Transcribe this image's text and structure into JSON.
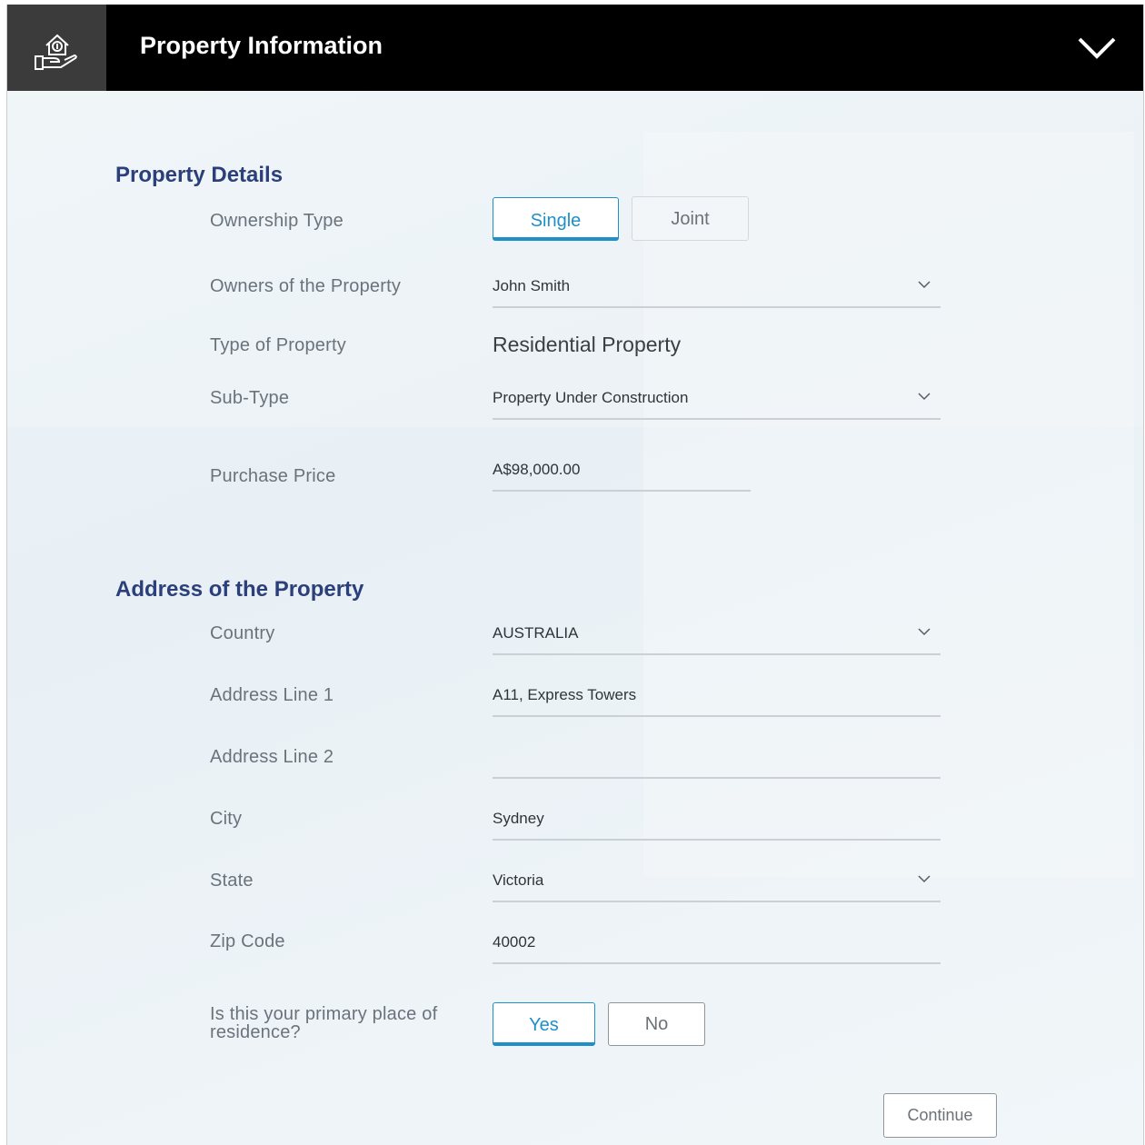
{
  "header": {
    "title": "Property Information",
    "icon": "home-loan-icon",
    "toggle_icon": "chevron-down-icon"
  },
  "property_details": {
    "section_title": "Property Details",
    "ownership_type": {
      "label": "Ownership Type",
      "options": [
        "Single",
        "Joint"
      ],
      "selected": "Single"
    },
    "owners": {
      "label": "Owners of the Property",
      "value": "John Smith"
    },
    "type_of_property": {
      "label": "Type of Property",
      "value": "Residential Property"
    },
    "sub_type": {
      "label": "Sub-Type",
      "value": "Property Under Construction"
    },
    "purchase_price": {
      "label": "Purchase Price",
      "value": "A$98,000.00"
    }
  },
  "address": {
    "section_title": "Address of the Property",
    "country": {
      "label": "Country",
      "value": "AUSTRALIA"
    },
    "address_line_1": {
      "label": "Address Line 1",
      "value": "A11, Express Towers"
    },
    "address_line_2": {
      "label": "Address Line 2",
      "value": ""
    },
    "city": {
      "label": "City",
      "value": "Sydney"
    },
    "state": {
      "label": "State",
      "value": "Victoria"
    },
    "zip_code": {
      "label": "Zip Code",
      "value": "40002"
    },
    "primary_residence": {
      "label": "Is this your primary place of residence?",
      "options": [
        "Yes",
        "No"
      ],
      "selected": "Yes"
    }
  },
  "actions": {
    "continue_label": "Continue"
  },
  "colors": {
    "header_bg": "#000000",
    "section_title": "#2b3f7a",
    "accent": "#1d8fc9"
  }
}
